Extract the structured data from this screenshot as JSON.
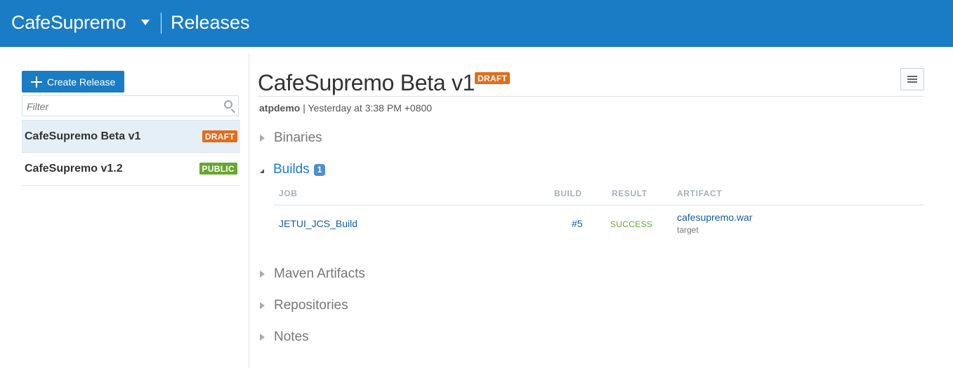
{
  "header": {
    "project": "CafeSupremo",
    "page": "Releases"
  },
  "sidebar": {
    "create_label": "Create Release",
    "filter_placeholder": "Filter",
    "releases": [
      {
        "name": "CafeSupremo Beta v1",
        "status": "DRAFT"
      },
      {
        "name": "CafeSupremo v1.2",
        "status": "PUBLIC"
      }
    ]
  },
  "main": {
    "title": "CafeSupremo Beta v1",
    "status": "DRAFT",
    "author": "atpdemo",
    "timestamp": "| Yesterday at 3:38 PM +0800",
    "sections": {
      "binaries": "Binaries",
      "builds": "Builds",
      "builds_count": "1",
      "maven": "Maven Artifacts",
      "repositories": "Repositories",
      "notes": "Notes"
    },
    "builds_table": {
      "headers": {
        "job": "JOB",
        "build": "BUILD",
        "result": "RESULT",
        "artifact": "ARTIFACT"
      },
      "rows": [
        {
          "job": "JETUI_JCS_Build",
          "build": "#5",
          "result": "SUCCESS",
          "artifact": "cafesupremo.war",
          "artifact_sub": "target"
        }
      ]
    }
  },
  "colors": {
    "header_bg": "#1a7cc4",
    "draft": "#e36c19",
    "public": "#66a82f",
    "success": "#66a82f",
    "link": "#145c9e"
  }
}
